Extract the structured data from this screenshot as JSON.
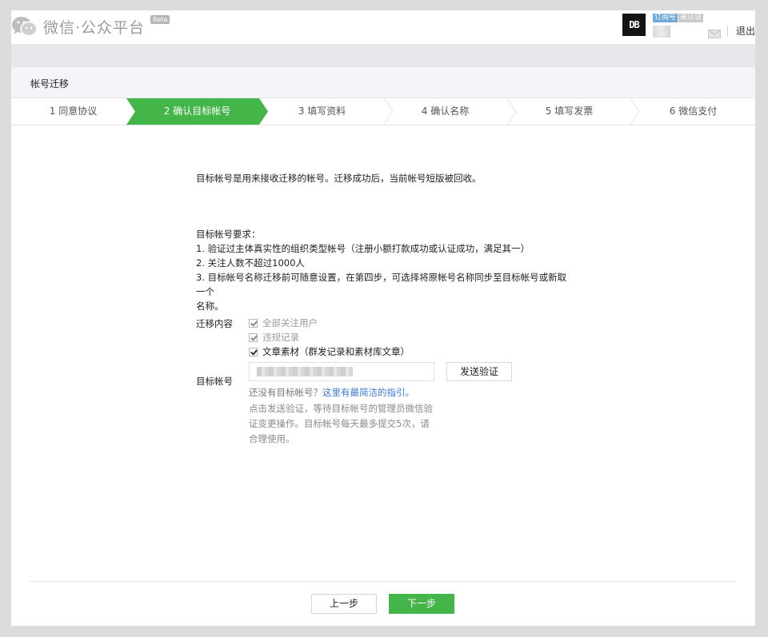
{
  "header": {
    "app_title": "微信·公众平台",
    "beta": "Beta",
    "account_avatar": "DB",
    "account_type_badge": "订阅号",
    "account_auth_badge": "未认证",
    "logout_label": "退出",
    "mail_icon": "mail-icon",
    "logo_icon": "wechat-logo-icon"
  },
  "page": {
    "title": "帐号迁移"
  },
  "steps": [
    {
      "label": "1 同意协议",
      "active": false
    },
    {
      "label": "2 确认目标帐号",
      "active": true
    },
    {
      "label": "3 填写资料",
      "active": false
    },
    {
      "label": "4 确认名称",
      "active": false
    },
    {
      "label": "5 填写发票",
      "active": false
    },
    {
      "label": "6 微信支付",
      "active": false
    }
  ],
  "content": {
    "intro": "目标帐号是用来接收迁移的帐号。迁移成功后，当前帐号短版被回收。",
    "requirements_title": "目标帐号要求：",
    "requirements": [
      "1. 验证过主体真实性的组织类型帐号（注册小额打款成功或认证成功，满足其一）",
      "2. 关注人数不超过1000人",
      "3. 目标帐号名称迁移前可随意设置，在第四步，可选择将原帐号名称同步至目标帐号或新取一个",
      "名称。"
    ],
    "migrate_content_label": "迁移内容",
    "migrate_items": [
      {
        "label": "全部关注用户",
        "checked": true,
        "enabled": false
      },
      {
        "label": "违规记录",
        "checked": true,
        "enabled": false
      },
      {
        "label": "文章素材（群发记录和素材库文章）",
        "checked": true,
        "enabled": true
      }
    ],
    "target_account_label": "目标帐号",
    "send_button": "发送验证",
    "no_account_text": "还没有目标帐号？",
    "guide_link": "这里有最简洁的指引。",
    "hint": "点击发送验证，等待目标帐号的管理员微信验证变更操作。目标帐号每天最多提交5次，请合理使用。"
  },
  "footer": {
    "prev": "上一步",
    "next": "下一步"
  },
  "colors": {
    "accent_green": "#44b549",
    "link_blue": "#3b7ad6",
    "step_border": "#e3e4e6"
  }
}
